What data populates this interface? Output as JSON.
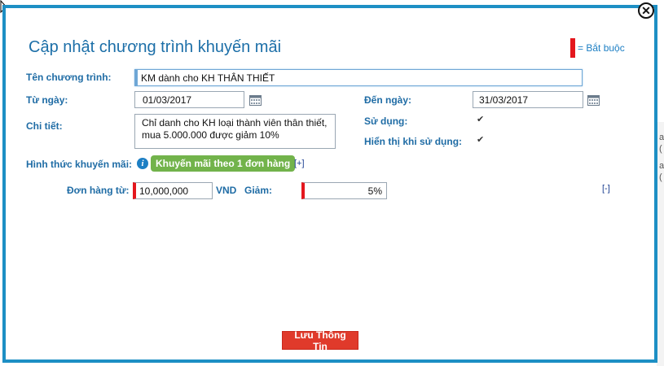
{
  "dialog": {
    "title": "Cập nhật chương trình khuyến mãi",
    "close_symbol": "✕",
    "required_legend": "= Bắt buộc"
  },
  "form": {
    "program_name": {
      "label": "Tên chương trình:",
      "value": "KM dành cho KH THÂN THIẾT"
    },
    "from_date": {
      "label": "Từ ngày:",
      "value": "01/03/2017"
    },
    "to_date": {
      "label": "Đến ngày:",
      "value": "31/03/2017"
    },
    "detail": {
      "label": "Chi tiết:",
      "value": "Chỉ danh cho KH loại thành viên thân thiết, mua 5.000.000 được giảm 10%"
    },
    "in_use": {
      "label": "Sử dụng:",
      "checked": true
    },
    "show_on_use": {
      "label": "Hiển thị khi sử dụng:",
      "checked": true
    },
    "promo_type": {
      "label": "Hình thức khuyến mãi:",
      "badge": "Khuyến mãi theo 1 đơn hàng",
      "add_link": "[+]"
    },
    "order_from": {
      "label": "Đơn hàng từ:",
      "value": "10,000,000",
      "unit": "VND"
    },
    "discount": {
      "label": "Giảm:",
      "value": "5%"
    },
    "remove_link": "[-]"
  },
  "save_button": "Lưu Thông Tin",
  "background_fragments": [
    "a",
    "(",
    "a",
    "("
  ],
  "colors": {
    "accent": "#1d8fc4",
    "required": "#e4171d",
    "badge": "#72b34b",
    "save": "#e03a2b"
  },
  "icons": [
    "close-icon",
    "calendar-icon",
    "info-icon",
    "checkbox-icon",
    "cursor-icon"
  ]
}
